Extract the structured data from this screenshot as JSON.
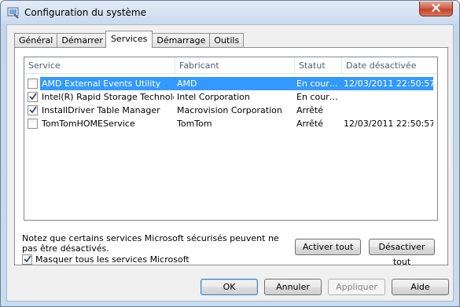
{
  "window": {
    "title": "Configuration du système",
    "icon": "msconfig-icon"
  },
  "tabs": [
    {
      "label": "Général",
      "active": false
    },
    {
      "label": "Démarrer",
      "active": false
    },
    {
      "label": "Services",
      "active": true
    },
    {
      "label": "Démarrage",
      "active": false
    },
    {
      "label": "Outils",
      "active": false
    }
  ],
  "services": {
    "columns": [
      "Service",
      "Fabricant",
      "Statut",
      "Date désactivée"
    ],
    "rows": [
      {
        "checked": false,
        "selected": true,
        "service": "AMD External Events Utility",
        "fabricant": "AMD",
        "statut": "En cour…",
        "date": "12/03/2011 22:50:57"
      },
      {
        "checked": true,
        "selected": false,
        "service": "Intel(R) Rapid Storage Technology",
        "fabricant": "Intel Corporation",
        "statut": "En cour…",
        "date": ""
      },
      {
        "checked": true,
        "selected": false,
        "service": "InstallDriver Table Manager",
        "fabricant": "Macrovision Corporation",
        "statut": "Arrêté",
        "date": ""
      },
      {
        "checked": false,
        "selected": false,
        "service": "TomTomHOMEService",
        "fabricant": "TomTom",
        "statut": "Arrêté",
        "date": "12/03/2011 22:50:57"
      }
    ]
  },
  "note": "Notez que certains services Microsoft sécurisés peuvent ne pas être désactivés.",
  "hide_ms": {
    "label": "Masquer tous les services Microsoft",
    "checked": true
  },
  "buttons": {
    "enable_all": "Activer tout",
    "disable_all": "Désactiver tout",
    "ok": "OK",
    "cancel": "Annuler",
    "apply": "Appliquer",
    "help": "Aide"
  }
}
